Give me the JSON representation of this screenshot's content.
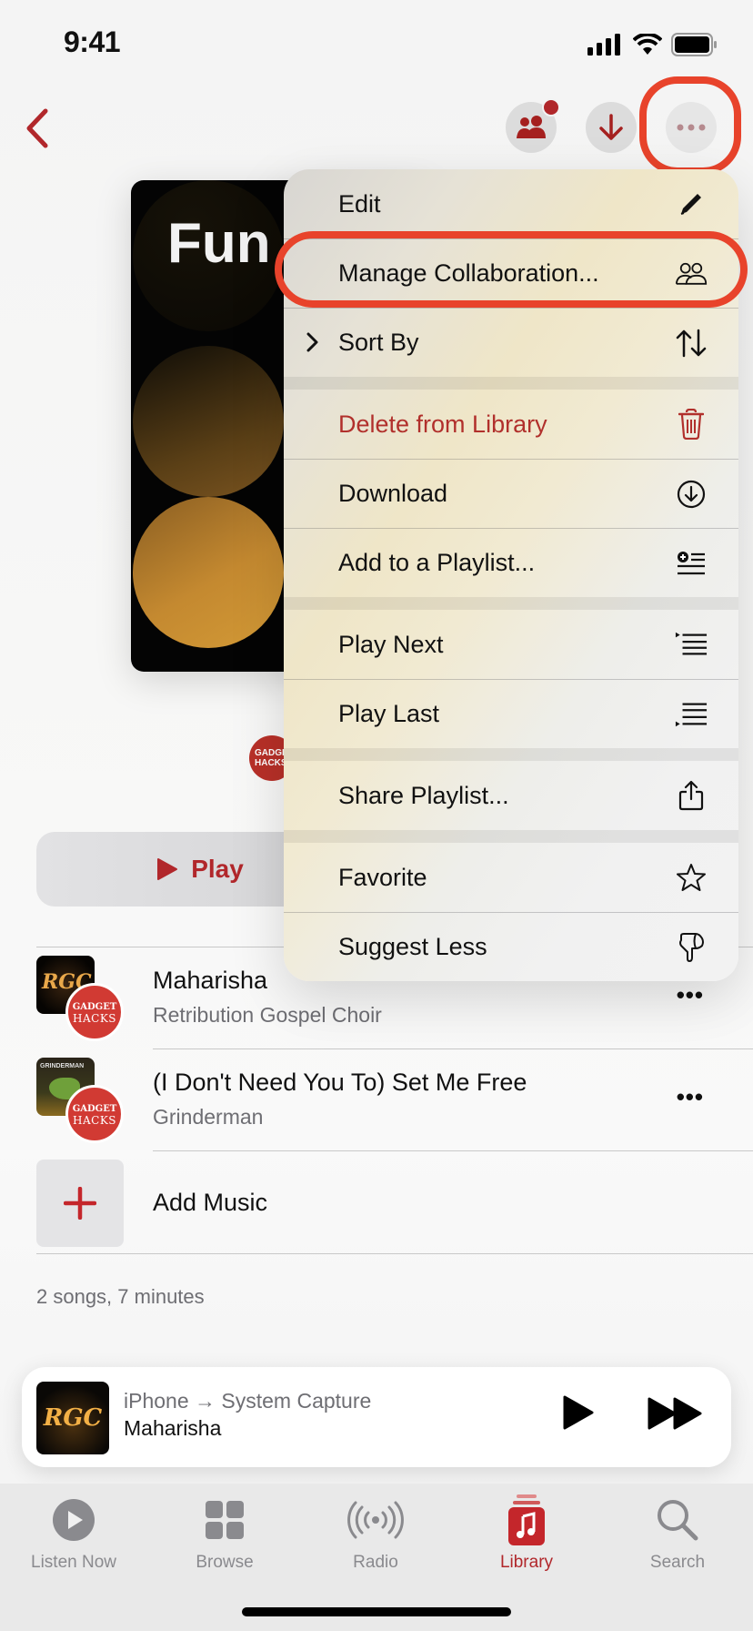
{
  "status_bar": {
    "time": "9:41"
  },
  "nav": {
    "back_icon": "chevron-left-icon",
    "collaborate_icon": "person-2-fill-icon",
    "download_icon": "arrow-down-icon",
    "more_icon": "ellipsis-icon",
    "collaborate_badge": true
  },
  "playlist": {
    "artwork_title": "Fun",
    "author_avatar_text": [
      "GADGET",
      "HACKS"
    ]
  },
  "play_button": {
    "label": "Play"
  },
  "context_menu": {
    "groups": [
      [
        {
          "label": "Edit",
          "icon": "pencil-icon"
        },
        {
          "label": "Manage Collaboration...",
          "icon": "person-2-icon",
          "highlighted": true
        },
        {
          "label": "Sort By",
          "icon": "arrow-up-arrow-down-icon",
          "has_submenu": true
        }
      ],
      [
        {
          "label": "Delete from Library",
          "icon": "trash-icon",
          "destructive": true
        },
        {
          "label": "Download",
          "icon": "arrow-down-circle-icon"
        },
        {
          "label": "Add to a Playlist...",
          "icon": "text-badge-plus-icon"
        }
      ],
      [
        {
          "label": "Play Next",
          "icon": "text-insert-top-icon"
        },
        {
          "label": "Play Last",
          "icon": "text-insert-bottom-icon"
        }
      ],
      [
        {
          "label": "Share Playlist...",
          "icon": "square-and-arrow-up-icon"
        }
      ],
      [
        {
          "label": "Favorite",
          "icon": "star-icon"
        },
        {
          "label": "Suggest Less",
          "icon": "hand-thumbsdown-icon"
        }
      ]
    ]
  },
  "songs": [
    {
      "title": "Maharisha",
      "artist": "Retribution Gospel Choir",
      "art_text": "RGC",
      "contributor": [
        "GADGET",
        "HACKS"
      ]
    },
    {
      "title": "(I Don't Need You To) Set Me Free",
      "artist": "Grinderman",
      "art_text": "GRINDERMAN",
      "contributor": [
        "GADGET",
        "HACKS"
      ]
    }
  ],
  "add_music": {
    "label": "Add Music"
  },
  "summary": "2 songs, 7 minutes",
  "mini_player": {
    "source": "iPhone → System Capture",
    "title": "Maharisha",
    "art_text": "RGC"
  },
  "tabs": [
    {
      "label": "Listen Now",
      "icon": "play-circle-fill-icon",
      "active": false
    },
    {
      "label": "Browse",
      "icon": "square-grid-2x2-icon",
      "active": false
    },
    {
      "label": "Radio",
      "icon": "dot-radiowaves-icon",
      "active": false
    },
    {
      "label": "Library",
      "icon": "music-note-library-icon",
      "active": true
    },
    {
      "label": "Search",
      "icon": "magnifyingglass-icon",
      "active": false
    }
  ],
  "colors": {
    "accent": "#b1272b",
    "annotation": "#e8432b",
    "secondary_text": "#6e6e73"
  }
}
